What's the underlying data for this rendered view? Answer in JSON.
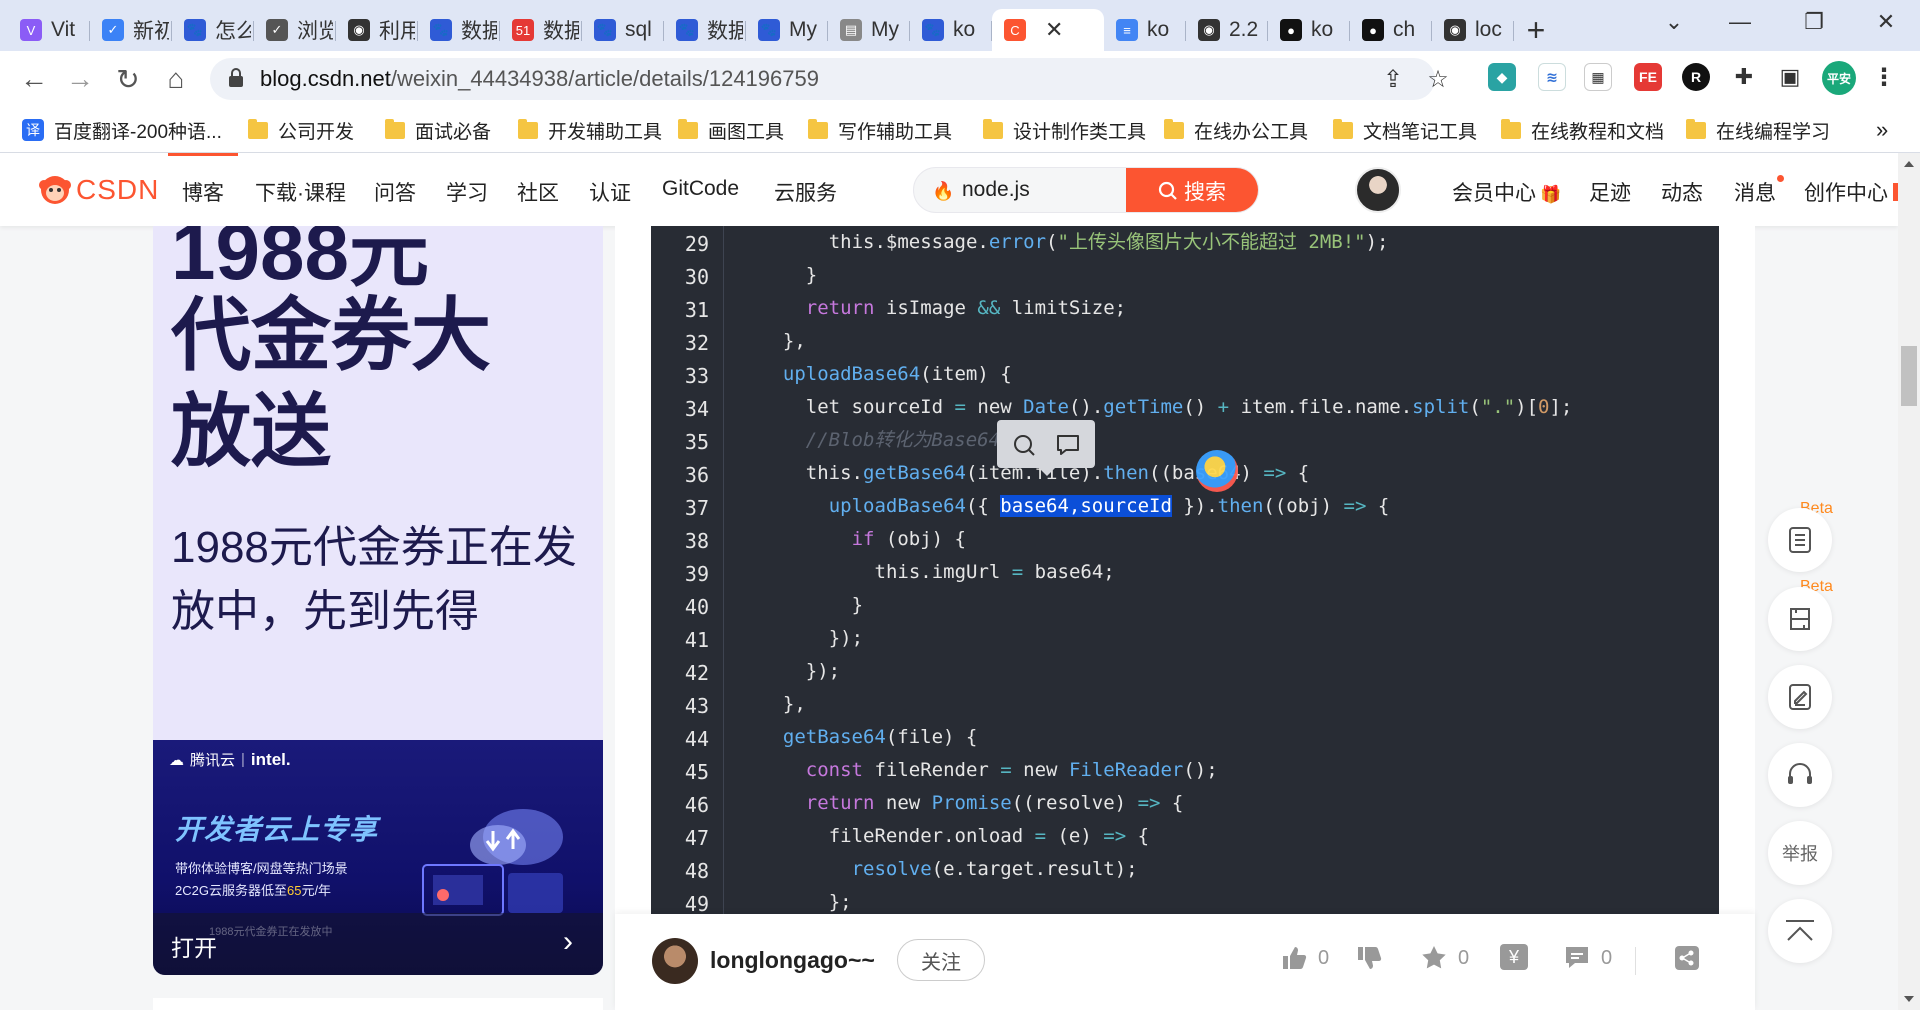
{
  "browser": {
    "tabs": [
      {
        "label": "Vit",
        "icon": "vite-icon",
        "color": "#8b5cf6",
        "glyph": "V"
      },
      {
        "label": "新初",
        "icon": "shield-check-icon",
        "color": "#3b82f6",
        "glyph": "✓"
      },
      {
        "label": "怎么",
        "icon": "baidu-paw-icon",
        "color": "#2f5bd6",
        "glyph": "🐾"
      },
      {
        "label": "浏览",
        "icon": "check-icon",
        "color": "#555555",
        "glyph": "✓"
      },
      {
        "label": "利用",
        "icon": "globe-icon",
        "color": "#333333",
        "glyph": "◉"
      },
      {
        "label": "数据",
        "icon": "baidu-paw-icon",
        "color": "#2f5bd6",
        "glyph": "🐾"
      },
      {
        "label": "数据",
        "icon": "51cto-icon",
        "color": "#e53935",
        "glyph": "51"
      },
      {
        "label": "sql",
        "icon": "baidu-paw-icon",
        "color": "#2f5bd6",
        "glyph": "🐾"
      },
      {
        "label": "数据",
        "icon": "baidu-paw-icon",
        "color": "#2f5bd6",
        "glyph": "🐾"
      },
      {
        "label": "My",
        "icon": "baidu-paw-icon",
        "color": "#2f5bd6",
        "glyph": "🐾"
      },
      {
        "label": "My",
        "icon": "document-icon",
        "color": "#888888",
        "glyph": "▤"
      },
      {
        "label": "ko",
        "icon": "baidu-paw-icon",
        "color": "#2f5bd6",
        "glyph": "🐾"
      }
    ],
    "active_tab": {
      "label": "",
      "icon": "csdn-c-icon",
      "color": "#fc5531",
      "glyph": "C",
      "close": "✕"
    },
    "tabs_after": [
      {
        "label": "ko",
        "icon": "docs-icon",
        "color": "#4285f4",
        "glyph": "≡"
      },
      {
        "label": "2.2",
        "icon": "globe-icon",
        "color": "#333333",
        "glyph": "◉"
      },
      {
        "label": "ko",
        "icon": "github-icon",
        "color": "#111111",
        "glyph": "●"
      },
      {
        "label": "ch",
        "icon": "github-icon",
        "color": "#111111",
        "glyph": "●"
      },
      {
        "label": "loc",
        "icon": "globe-icon",
        "color": "#333333",
        "glyph": "◉"
      }
    ],
    "new_tab": "+",
    "url_host": "blog.csdn.net",
    "url_path": "/weixin_44434938/article/details/124196759",
    "ext_avatar_label": "平安",
    "bookmarks": [
      {
        "label": "百度翻译-200种语...",
        "type": "app"
      },
      {
        "label": "公司开发",
        "type": "folder"
      },
      {
        "label": "面试必备",
        "type": "folder"
      },
      {
        "label": "开发辅助工具",
        "type": "folder"
      },
      {
        "label": "画图工具",
        "type": "folder"
      },
      {
        "label": "写作辅助工具",
        "type": "folder"
      },
      {
        "label": "设计制作类工具",
        "type": "folder"
      },
      {
        "label": "在线办公工具",
        "type": "folder"
      },
      {
        "label": "文档笔记工具",
        "type": "folder"
      },
      {
        "label": "在线教程和文档",
        "type": "folder"
      },
      {
        "label": "在线编程学习",
        "type": "folder"
      }
    ],
    "bookmarks_more": "»",
    "bookmark_app_glyph": "译"
  },
  "csdn": {
    "logo_text": "CSDN",
    "nav": [
      "博客",
      "下载·课程",
      "问答",
      "学习",
      "社区",
      "认证",
      "GitCode",
      "云服务"
    ],
    "search_value": "node.js",
    "search_button": "搜索",
    "user_nav": [
      "会员中心",
      "足迹",
      "动态",
      "消息",
      "创作中心"
    ]
  },
  "ads": {
    "ad1_line0": "1988元",
    "ad1_line1": "代金券大",
    "ad1_line2": "放送",
    "ad1_sub": "1988元代金券正在发放中，先到先得",
    "ad2_brand_cloud": "腾讯云",
    "ad2_brand_intel": "intel.",
    "ad2_title": "开发者云上专享",
    "ad2_desc1": "带你体验博客/网盘等热门场景",
    "ad2_desc2_pre": "2C2G云服务器低至",
    "ad2_desc2_hl": "65",
    "ad2_desc2_post": "元/年",
    "ad2_open": "打开",
    "ad2_faint": "1988元代金券正在发放中"
  },
  "code": {
    "lines": [
      {
        "n": "29",
        "indent": 6,
        "tokens": [
          [
            "p",
            "this.$message."
          ],
          [
            "f",
            "error"
          ],
          [
            "p",
            "("
          ],
          [
            "s",
            "\"上传头像图片大小不能超过 2MB!\""
          ],
          [
            "p",
            ");"
          ]
        ]
      },
      {
        "n": "30",
        "indent": 4,
        "tokens": [
          [
            "p",
            "}"
          ]
        ]
      },
      {
        "n": "31",
        "indent": 4,
        "tokens": [
          [
            "k",
            "return "
          ],
          [
            "p",
            "isImage "
          ],
          [
            "o",
            "&&"
          ],
          [
            "p",
            " limitSize;"
          ]
        ]
      },
      {
        "n": "32",
        "indent": 2,
        "tokens": [
          [
            "p",
            "},"
          ]
        ]
      },
      {
        "n": "33",
        "indent": 2,
        "tokens": [
          [
            "f",
            "uploadBase64"
          ],
          [
            "p",
            "(item) {"
          ]
        ]
      },
      {
        "n": "34",
        "indent": 4,
        "tokens": [
          [
            "p",
            "let sourceId "
          ],
          [
            "o",
            "="
          ],
          [
            "p",
            " new "
          ],
          [
            "f",
            "Date"
          ],
          [
            "p",
            "()."
          ],
          [
            "f",
            "getTime"
          ],
          [
            "p",
            "() "
          ],
          [
            "o",
            "+"
          ],
          [
            "p",
            " item.file.name."
          ],
          [
            "f",
            "split"
          ],
          [
            "p",
            "("
          ],
          [
            "s",
            "\".\""
          ],
          [
            "p",
            ")["
          ],
          [
            "n",
            "0"
          ],
          [
            "p",
            "];"
          ]
        ]
      },
      {
        "n": "35",
        "indent": 4,
        "tokens": [
          [
            "c",
            "//Blob转化为Base64"
          ]
        ]
      },
      {
        "n": "36",
        "indent": 4,
        "tokens": [
          [
            "p",
            "this."
          ],
          [
            "f",
            "getBase64"
          ],
          [
            "p",
            "(item.file)."
          ],
          [
            "f",
            "then"
          ],
          [
            "p",
            "((base64) "
          ],
          [
            "o",
            "=>"
          ],
          [
            "p",
            " {"
          ]
        ]
      },
      {
        "n": "37",
        "indent": 6,
        "tokens": [
          [
            "f",
            "uploadBase64"
          ],
          [
            "p",
            "({ "
          ],
          [
            "sel",
            "base64,sourceId"
          ],
          [
            "p",
            " })."
          ],
          [
            "f",
            "then"
          ],
          [
            "p",
            "((obj) "
          ],
          [
            "o",
            "=>"
          ],
          [
            "p",
            " {"
          ]
        ]
      },
      {
        "n": "38",
        "indent": 8,
        "tokens": [
          [
            "k",
            "if"
          ],
          [
            "p",
            " (obj) {"
          ]
        ]
      },
      {
        "n": "39",
        "indent": 10,
        "tokens": [
          [
            "p",
            "this.imgUrl "
          ],
          [
            "o",
            "="
          ],
          [
            "p",
            " base64;"
          ]
        ]
      },
      {
        "n": "40",
        "indent": 8,
        "tokens": [
          [
            "p",
            "}"
          ]
        ]
      },
      {
        "n": "41",
        "indent": 6,
        "tokens": [
          [
            "p",
            "});"
          ]
        ]
      },
      {
        "n": "42",
        "indent": 4,
        "tokens": [
          [
            "p",
            "});"
          ]
        ]
      },
      {
        "n": "43",
        "indent": 2,
        "tokens": [
          [
            "p",
            "},"
          ]
        ]
      },
      {
        "n": "44",
        "indent": 2,
        "tokens": [
          [
            "f",
            "getBase64"
          ],
          [
            "p",
            "(file) {"
          ]
        ]
      },
      {
        "n": "45",
        "indent": 4,
        "tokens": [
          [
            "k",
            "const"
          ],
          [
            "p",
            " fileRender "
          ],
          [
            "o",
            "="
          ],
          [
            "p",
            " new "
          ],
          [
            "f",
            "FileReader"
          ],
          [
            "p",
            "();"
          ]
        ]
      },
      {
        "n": "46",
        "indent": 4,
        "tokens": [
          [
            "k",
            "return"
          ],
          [
            "p",
            " new "
          ],
          [
            "f",
            "Promise"
          ],
          [
            "p",
            "((resolve) "
          ],
          [
            "o",
            "=>"
          ],
          [
            "p",
            " {"
          ]
        ]
      },
      {
        "n": "47",
        "indent": 6,
        "tokens": [
          [
            "p",
            "fileRender.onload "
          ],
          [
            "o",
            "="
          ],
          [
            "p",
            " (e) "
          ],
          [
            "o",
            "=>"
          ],
          [
            "p",
            " {"
          ]
        ]
      },
      {
        "n": "48",
        "indent": 8,
        "tokens": [
          [
            "f",
            "resolve"
          ],
          [
            "p",
            "(e.target.result);"
          ]
        ]
      },
      {
        "n": "49",
        "indent": 6,
        "tokens": [
          [
            "p",
            "};"
          ]
        ]
      }
    ]
  },
  "author": {
    "name": "longlongago~~",
    "follow": "关注",
    "like_count": "0",
    "collect_count": "0",
    "comment_count": "0",
    "reward_glyph": "¥"
  },
  "tools": {
    "beta_label": "Beta",
    "report_label": "举报"
  },
  "colors": {
    "csdn_red": "#fc5531",
    "code_bg": "#282c34",
    "selection": "#0b4fd8"
  }
}
